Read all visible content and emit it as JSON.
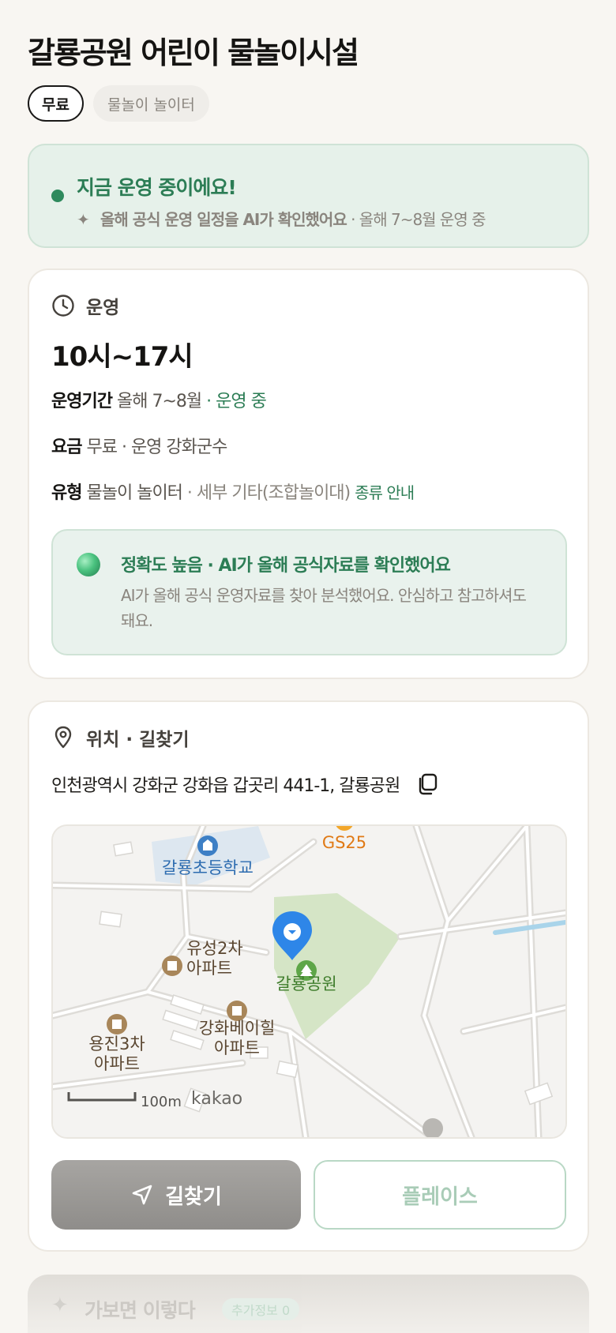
{
  "header": {
    "title": "갈룡공원 어린이 물놀이시설",
    "tags": [
      "무료",
      "물놀이 놀이터"
    ]
  },
  "status": {
    "title": "지금 운영 중이에요!",
    "sub_bold": "올해 공식 운영 일정을 AI가 확인했어요",
    "sub_rest": " · 올해 7~8월 운영 중"
  },
  "hours_card": {
    "label": "운영",
    "hours": "10시~17시",
    "period_key": "운영기간",
    "period_value": "올해 7~8월",
    "period_status": " · 운영 중",
    "fee_key": "요금",
    "fee_value": "무료 · 운영 강화군수",
    "type_key": "유형",
    "type_value": "물놀이 놀이터",
    "type_detail": " · 세부 기타(조합놀이대)",
    "type_link": "종류 안내",
    "ai_title": "정확도 높음 · AI가 올해 공식자료를 확인했어요",
    "ai_desc": "AI가 올해 공식 운영자료를 찾아 분석했어요. 안심하고 참고하셔도 돼요."
  },
  "location_card": {
    "label": "위치 · 길찾기",
    "address": "인천광역시 강화군 강화읍 갑곳리 441-1, 갈룡공원",
    "map": {
      "labels": {
        "school": "갈룡초등학교",
        "store": "GS25",
        "park": "갈룡공원",
        "apt1_l1": "유성2차",
        "apt1_l2": "아파트",
        "apt2_l1": "강화베이힐",
        "apt2_l2": "아파트",
        "apt3_l1": "용진3차",
        "apt3_l2": "아파트",
        "scale": "100m",
        "brand": "kakao"
      }
    },
    "nav_button": "길찾기",
    "place_button": "플레이스"
  },
  "peek": {
    "title": "가보면 이렇다",
    "badge": "추가정보 0"
  },
  "colors": {
    "accent_green": "#2c7d55",
    "status_bg": "#e6f1ea",
    "nav_button": "#9a9895"
  }
}
